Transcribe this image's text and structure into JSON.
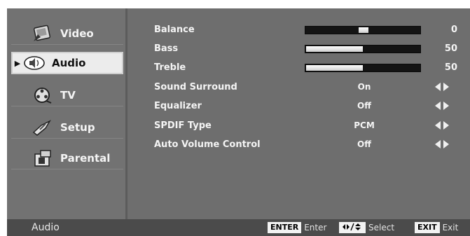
{
  "nav": {
    "items": [
      {
        "label": "Video",
        "icon": "video-icon"
      },
      {
        "label": "Audio",
        "icon": "audio-icon",
        "selected": true
      },
      {
        "label": "TV",
        "icon": "tv-reel-icon"
      },
      {
        "label": "Setup",
        "icon": "setup-icon"
      },
      {
        "label": "Parental",
        "icon": "parental-icon"
      }
    ]
  },
  "settings": {
    "balance": {
      "label": "Balance",
      "value": "0",
      "level": 0
    },
    "bass": {
      "label": "Bass",
      "value": "50",
      "level": 50
    },
    "treble": {
      "label": "Treble",
      "value": "50",
      "level": 50
    },
    "sound_surround": {
      "label": "Sound Surround",
      "value": "On"
    },
    "equalizer": {
      "label": "Equalizer",
      "value": "Off"
    },
    "spdif_type": {
      "label": "SPDIF Type",
      "value": "PCM"
    },
    "auto_volume": {
      "label": "Auto Volume Control",
      "value": "Off"
    }
  },
  "statusbar": {
    "menu_name": "Audio",
    "enter_key": "ENTER",
    "enter_text": "Enter",
    "select_text": "Select",
    "exit_key": "EXIT",
    "exit_text": "Exit"
  },
  "colors": {
    "background": "#6e6e6e",
    "selected": "#ececec",
    "statusbar": "#4b4b4b",
    "bar_track": "#141414"
  }
}
